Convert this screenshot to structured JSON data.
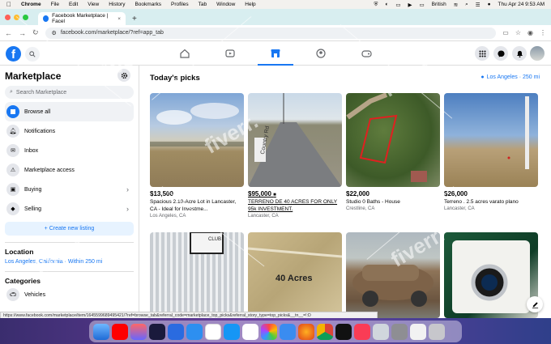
{
  "menubar": {
    "apple": "",
    "app": "Chrome",
    "items": [
      "File",
      "Edit",
      "View",
      "History",
      "Bookmarks",
      "Profiles",
      "Tab",
      "Window",
      "Help"
    ],
    "input_source": "British",
    "datetime": "Thu Apr 24  9:53 AM"
  },
  "browser": {
    "tab_title": "Facebook Marketplace | Facel",
    "tab_close": "×",
    "new_tab": "+",
    "url": "facebook.com/marketplace/?ref=app_tab"
  },
  "sidebar": {
    "title": "Marketplace",
    "search_placeholder": "Search Marketplace",
    "items": [
      {
        "label": "Browse all",
        "icon": "storefront-icon"
      },
      {
        "label": "Notifications",
        "icon": "bell-icon"
      },
      {
        "label": "Inbox",
        "icon": "messenger-icon"
      },
      {
        "label": "Marketplace access",
        "icon": "warning-icon"
      },
      {
        "label": "Buying",
        "icon": "bag-icon"
      },
      {
        "label": "Selling",
        "icon": "tag-icon"
      }
    ],
    "create_label": "+ Create new listing",
    "location_heading": "Location",
    "location_value": "Los Angeles, California · Within 250 mi",
    "categories_heading": "Categories",
    "category_first": "Vehicles"
  },
  "main": {
    "heading": "Today's picks",
    "location": "Los Angeles · 250 mi",
    "listings": [
      {
        "price": "$13,500",
        "title": "Spacious 2.10-Acre Lot in Lancaster, CA - Ideal for Investme...",
        "location": "Los Angeles, CA"
      },
      {
        "price": "$95,000",
        "title": "TERRENO DE 40 ACRES FOR ONLY 95k INVESTMENT.",
        "location": "Lancaster, CA"
      },
      {
        "price": "$22,000",
        "title": "Studio 0 Baths - House",
        "location": "Crestline, CA"
      },
      {
        "price": "$26,000",
        "title": "Terreno . 2.5 acres varato plano",
        "location": "Lancaster, CA"
      },
      {
        "price": "",
        "title": "",
        "location": ""
      },
      {
        "price": "",
        "title": "",
        "location": ""
      },
      {
        "price": "",
        "title": "",
        "location": ""
      },
      {
        "price": "",
        "title": "",
        "location": ""
      }
    ],
    "photo_texts": {
      "road_sign": "Country Rd",
      "acres": "40 Acres",
      "box": "CLUB"
    }
  },
  "status_url": "https://www.facebook.com/marketplace/item/1645599689495421/?ref=browse_tab&referral_code=marketplace_top_picks&referral_story_type=top_picks&__tn__=!:D",
  "watermark": "fiverr.",
  "colors": {
    "accent": "#1877f2",
    "dock_bg": "#3a2d6e"
  }
}
